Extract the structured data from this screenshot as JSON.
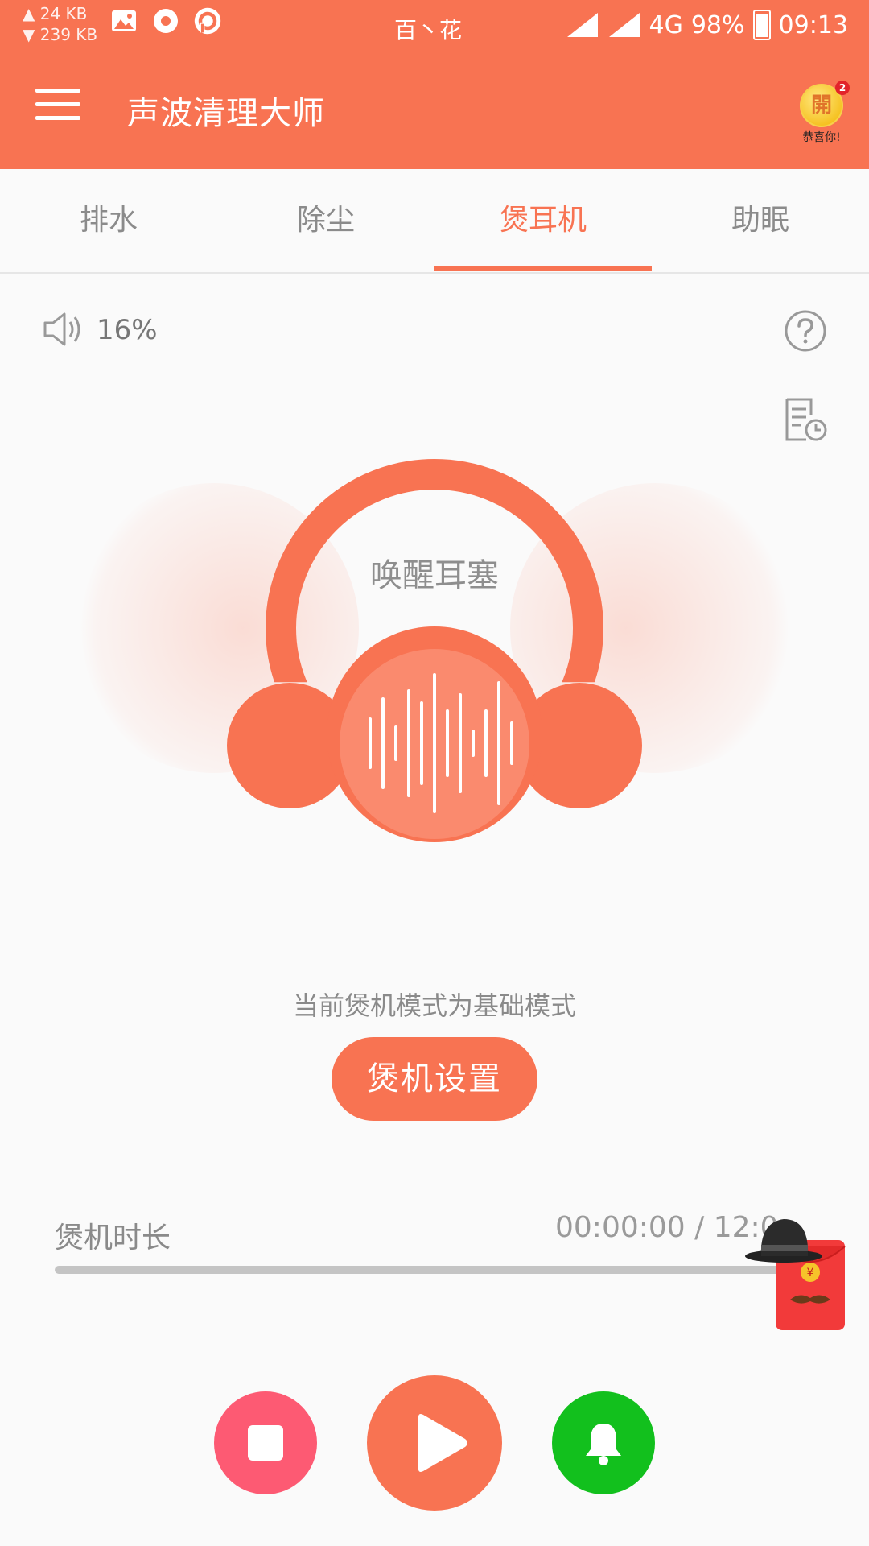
{
  "status_bar": {
    "upload_speed": "▲ 24 KB",
    "download_speed": "▼ 239 KB",
    "center_text": "百丶花",
    "network": "4G",
    "battery": "98%",
    "time": "09:13"
  },
  "app_bar": {
    "title": "声波清理大师",
    "bonus_coin": "開",
    "bonus_badge": "2",
    "bonus_text": "恭喜你!"
  },
  "tabs": [
    {
      "label": "排水",
      "active": false
    },
    {
      "label": "除尘",
      "active": false
    },
    {
      "label": "煲耳机",
      "active": true
    },
    {
      "label": "助眠",
      "active": false
    }
  ],
  "volume": {
    "label": "16%"
  },
  "headphone": {
    "label": "唤醒耳塞"
  },
  "mode": {
    "text": "当前煲机模式为基础模式",
    "button": "煲机设置"
  },
  "duration": {
    "label": "煲机时长",
    "time": "00:00:00 / 12:0",
    "progress": 0
  },
  "colors": {
    "accent": "#f87352",
    "stop": "#fd5a73",
    "bell": "#12c01d"
  },
  "icons": {
    "menu": "hamburger-icon",
    "volume": "speaker-icon",
    "help": "question-icon",
    "history": "document-clock-icon",
    "stop": "stop-icon",
    "play": "play-icon",
    "bell": "bell-icon"
  }
}
